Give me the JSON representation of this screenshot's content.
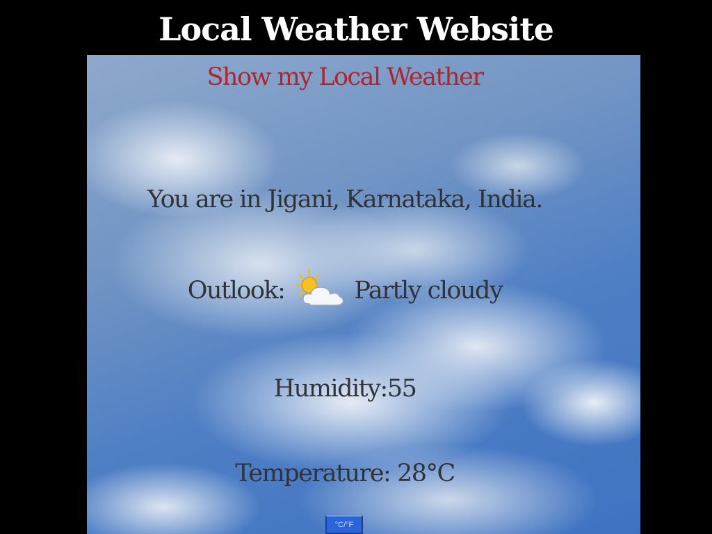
{
  "page": {
    "title": "Local Weather Website"
  },
  "panel": {
    "heading": "Show my Local Weather",
    "location_text": "You are in Jigani, Karnataka, India.",
    "outlook_label": "Outlook:",
    "outlook_value": "Partly cloudy",
    "outlook_icon": "partly-cloudy-icon",
    "humidity_text": "Humidity:55",
    "temperature_text": "Temperature: 28°C",
    "unit_toggle_label": "°C/°F"
  },
  "colors": {
    "page_background": "#000000",
    "title_text": "#ffffff",
    "heading_text": "#b0242c",
    "body_text": "#2f3236",
    "toggle_background": "#2b63d9"
  }
}
